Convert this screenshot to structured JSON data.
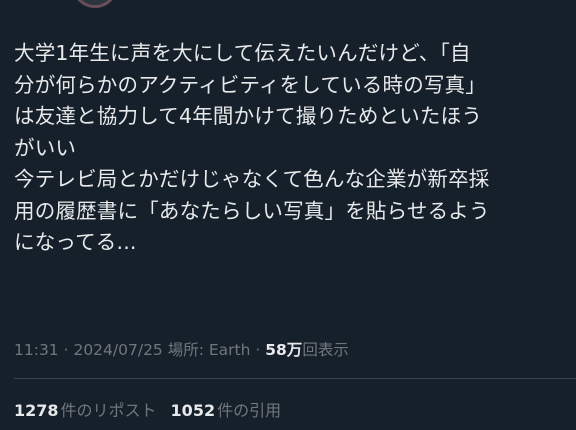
{
  "tweet": {
    "text": "大学1年生に声を大にして伝えたいんだけど、「自\n分が何らかのアクティビティをしている時の写真」\nは友達と協力して4年間かけて撮りためといたほう\nがいい\n今テレビ局とかだけじゃなくて色んな企業が新卒採\n用の履歴書に「あなたらしい写真」を貼らせるよう\nになってる..."
  },
  "meta": {
    "time": "11:31",
    "sep1": " · ",
    "date": "2024/07/25",
    "location": " 場所: Earth",
    "sep2": " · ",
    "views_count": "58万",
    "views_label": "回表示"
  },
  "stats": {
    "reposts_count": "1278",
    "reposts_label": "件のリポスト",
    "quotes_count": "1052",
    "quotes_label": "件の引用"
  }
}
